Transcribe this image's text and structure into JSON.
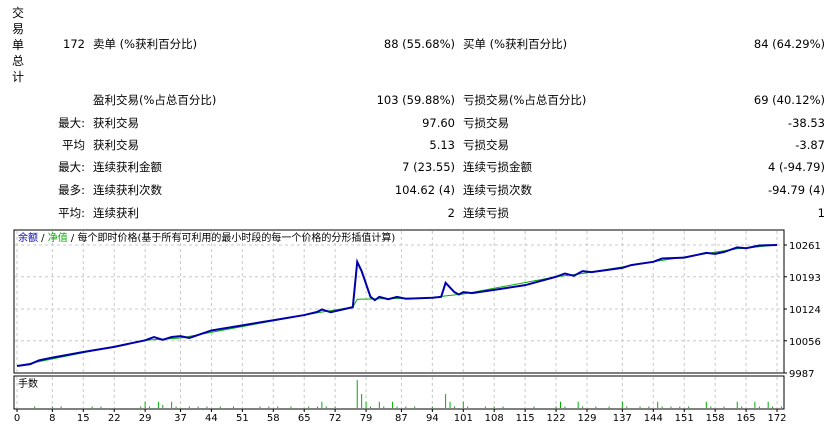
{
  "summary_header": "交易单总计",
  "rows": [
    {
      "k": "",
      "l1": "172",
      "n1": "卖单 (%获利百分比)",
      "v1": "88 (55.68%)",
      "n2": "买单 (%获利百分比)",
      "v2": "84 (64.29%)"
    },
    {
      "k": "",
      "l1": "",
      "n1": "盈利交易(%占总百分比)",
      "v1": "103 (59.88%)",
      "n2": "亏损交易(%占总百分比)",
      "v2": "69 (40.12%)"
    },
    {
      "k": "",
      "l1": "最大:",
      "n1": "获利交易",
      "v1": "97.60",
      "n2": "亏损交易",
      "v2": "-38.53"
    },
    {
      "k": "",
      "l1": "平均",
      "n1": "获利交易",
      "v1": "5.13",
      "n2": "亏损交易",
      "v2": "-3.87"
    },
    {
      "k": "",
      "l1": "最大:",
      "n1": "连续获利金额",
      "v1": "7 (23.55)",
      "n2": "连续亏损金额",
      "v2": "4 (-94.79)"
    },
    {
      "k": "",
      "l1": "最多:",
      "n1": "连续获利次数",
      "v1": "104.62 (4)",
      "n2": "连续亏损次数",
      "v2": "-94.79 (4)"
    },
    {
      "k": "",
      "l1": "平均:",
      "n1": "连续获利",
      "v1": "2",
      "n2": "连续亏损",
      "v2": "1"
    }
  ],
  "chart_data": {
    "type": "line",
    "legend": {
      "balance": "余额",
      "sep1": " / ",
      "equity": "净值",
      "sep2": " / ",
      "desc": "每个即时价格(基于所有可利用的最小时段的每一个价格的分形插值计算)"
    },
    "volume_label": "手数",
    "colors": {
      "balance": "#0000aa",
      "equity": "#00b000",
      "volume": "#00b000",
      "grid": "#c8c8c8"
    },
    "ylim": [
      9987,
      10261
    ],
    "y_ticks": [
      "10261",
      "10193",
      "10124",
      "10056",
      "9987"
    ],
    "x_ticks": [
      "0",
      "8",
      "15",
      "22",
      "29",
      "37",
      "44",
      "51",
      "58",
      "65",
      "72",
      "79",
      "87",
      "94",
      "101",
      "108",
      "115",
      "122",
      "129",
      "137",
      "144",
      "151",
      "158",
      "165",
      "172"
    ],
    "xlim": [
      0,
      172
    ],
    "balance": [
      [
        0,
        10002
      ],
      [
        3,
        10006
      ],
      [
        5,
        10014
      ],
      [
        8,
        10020
      ],
      [
        15,
        10032
      ],
      [
        22,
        10043
      ],
      [
        29,
        10057
      ],
      [
        31,
        10064
      ],
      [
        33,
        10058
      ],
      [
        35,
        10064
      ],
      [
        37,
        10066
      ],
      [
        39,
        10062
      ],
      [
        44,
        10078
      ],
      [
        51,
        10089
      ],
      [
        58,
        10100
      ],
      [
        65,
        10111
      ],
      [
        68,
        10118
      ],
      [
        69,
        10123
      ],
      [
        71,
        10117
      ],
      [
        76,
        10128
      ],
      [
        77,
        10225
      ],
      [
        78,
        10205
      ],
      [
        80,
        10150
      ],
      [
        81,
        10143
      ],
      [
        82,
        10150
      ],
      [
        84,
        10145
      ],
      [
        86,
        10150
      ],
      [
        88,
        10146
      ],
      [
        94,
        10148
      ],
      [
        96,
        10150
      ],
      [
        97,
        10180
      ],
      [
        99,
        10160
      ],
      [
        100,
        10155
      ],
      [
        101,
        10160
      ],
      [
        103,
        10158
      ],
      [
        108,
        10165
      ],
      [
        115,
        10175
      ],
      [
        122,
        10193
      ],
      [
        124,
        10200
      ],
      [
        126,
        10195
      ],
      [
        128,
        10205
      ],
      [
        130,
        10203
      ],
      [
        137,
        10212
      ],
      [
        139,
        10218
      ],
      [
        144,
        10225
      ],
      [
        146,
        10232
      ],
      [
        151,
        10234
      ],
      [
        154,
        10240
      ],
      [
        156,
        10244
      ],
      [
        158,
        10242
      ],
      [
        160,
        10246
      ],
      [
        163,
        10256
      ],
      [
        165,
        10254
      ],
      [
        168,
        10260
      ],
      [
        172,
        10261
      ]
    ],
    "equity": [
      [
        0,
        10002
      ],
      [
        29,
        10057
      ],
      [
        37,
        10062
      ],
      [
        68,
        10116
      ],
      [
        76,
        10128
      ],
      [
        77,
        10145
      ],
      [
        94,
        10148
      ],
      [
        97,
        10152
      ],
      [
        101,
        10156
      ],
      [
        122,
        10193
      ],
      [
        128,
        10200
      ],
      [
        144,
        10225
      ],
      [
        163,
        10253
      ],
      [
        172,
        10261
      ]
    ],
    "volume": [
      [
        4,
        0.1
      ],
      [
        8,
        0.1
      ],
      [
        10,
        0.1
      ],
      [
        17,
        0.1
      ],
      [
        19,
        0.1
      ],
      [
        28,
        0.1
      ],
      [
        29,
        0.4
      ],
      [
        30,
        0.1
      ],
      [
        32,
        0.4
      ],
      [
        33,
        0.2
      ],
      [
        35,
        0.4
      ],
      [
        36,
        0.1
      ],
      [
        39,
        0.1
      ],
      [
        41,
        0.1
      ],
      [
        43,
        0.1
      ],
      [
        46,
        0.1
      ],
      [
        49,
        0.1
      ],
      [
        55,
        0.1
      ],
      [
        57,
        0.1
      ],
      [
        59,
        0.1
      ],
      [
        62,
        0.1
      ],
      [
        66,
        0.1
      ],
      [
        68,
        0.1
      ],
      [
        69,
        0.4
      ],
      [
        70,
        0.1
      ],
      [
        72,
        0.1
      ],
      [
        77,
        1.8
      ],
      [
        78,
        0.9
      ],
      [
        79,
        0.4
      ],
      [
        80,
        0.1
      ],
      [
        82,
        0.4
      ],
      [
        83,
        0.1
      ],
      [
        85,
        0.4
      ],
      [
        86,
        0.1
      ],
      [
        88,
        0.1
      ],
      [
        90,
        0.1
      ],
      [
        94,
        0.1
      ],
      [
        97,
        0.9
      ],
      [
        98,
        0.4
      ],
      [
        99,
        0.1
      ],
      [
        101,
        0.4
      ],
      [
        102,
        0.1
      ],
      [
        106,
        0.1
      ],
      [
        108,
        0.1
      ],
      [
        110,
        0.1
      ],
      [
        117,
        0.1
      ],
      [
        122,
        0.1
      ],
      [
        123,
        0.4
      ],
      [
        124,
        0.1
      ],
      [
        127,
        0.4
      ],
      [
        128,
        0.1
      ],
      [
        131,
        0.1
      ],
      [
        134,
        0.1
      ],
      [
        137,
        0.4
      ],
      [
        138,
        0.1
      ],
      [
        141,
        0.1
      ],
      [
        143,
        0.1
      ],
      [
        145,
        0.4
      ],
      [
        146,
        0.1
      ],
      [
        148,
        0.1
      ],
      [
        150,
        0.1
      ],
      [
        152,
        0.1
      ],
      [
        156,
        0.4
      ],
      [
        157,
        0.1
      ],
      [
        160,
        0.1
      ],
      [
        163,
        0.4
      ],
      [
        164,
        0.1
      ],
      [
        167,
        0.4
      ],
      [
        168,
        0.1
      ],
      [
        170,
        0.4
      ],
      [
        171,
        0.1
      ],
      [
        173,
        0.1
      ]
    ],
    "volume_max": 2.0
  }
}
